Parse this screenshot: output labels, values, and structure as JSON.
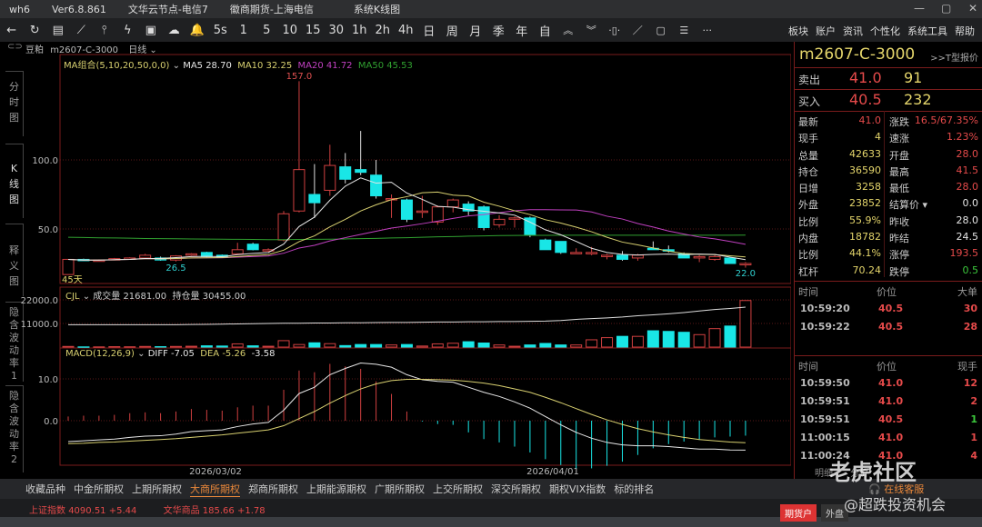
{
  "titlebar": {
    "app": "wh6",
    "version": "Ver6.8.861",
    "node": "文华云节点-电信7",
    "broker": "徽商期货-上海电信",
    "view": "系统K线图"
  },
  "toolbar": {
    "icons": [
      "back-icon",
      "refresh-icon",
      "table-icon",
      "line-chart-icon",
      "candle-icon",
      "flash-icon",
      "quote-board-icon",
      "cloud-icon",
      "bell-icon"
    ],
    "periods": [
      "5s",
      "1",
      "5",
      "10",
      "15",
      "30",
      "1h",
      "2h",
      "4h",
      "日",
      "周",
      "月",
      "季",
      "年",
      "自"
    ],
    "tools": [
      "expand-up-icon",
      "expand-down-icon",
      "fit-width-icon",
      "draw-line-icon",
      "rectangle-icon",
      "list-icon",
      "more-icon"
    ],
    "tool_glyphs": [
      "︽",
      "︾",
      "·▯·",
      "／",
      "▢",
      "☰",
      "···"
    ],
    "menu": [
      "板块",
      "账户",
      "资讯",
      "个性化",
      "系统工具",
      "帮助"
    ]
  },
  "header": {
    "name": "豆粕",
    "code": "m2607-C-3000",
    "period": "日线"
  },
  "sidebar": [
    "分时图",
    "K线图",
    "释义图",
    "隐含波动率1",
    "隐含波动率2"
  ],
  "legend": {
    "ma_label": "MA组合(5,10,20,50,0,0)",
    "ma5": "MA5 28.70",
    "ma10": "MA10 32.25",
    "ma20": "MA20 41.72",
    "ma50": "MA50 45.53",
    "cjl": "CJL",
    "vol": "成交量 21681.00",
    "oi": "持仓量 30455.00",
    "macd": "MACD(12,26,9)",
    "diff": "DIFF -7.05",
    "dea": "DEA -5.26",
    "hist": "-3.58",
    "high_label": "157.0",
    "low_label": "26.5",
    "last_low_label": "22.0",
    "days": "45天"
  },
  "colors": {
    "up": "#d04040",
    "down": "#19e6e6",
    "ma5": "#e6e6e6",
    "ma10": "#d8d070",
    "ma20": "#c040c0",
    "ma50": "#30a030",
    "yellow": "#e4d56b",
    "red": "#e54a4a",
    "green": "#3cc83c"
  },
  "chart_data": {
    "type": "candlestick",
    "price_axis": [
      "100.0",
      "50.0"
    ],
    "volume_axis": [
      "22000.0",
      "11000.0"
    ],
    "macd_axis": [
      "10.0",
      "0.0"
    ],
    "dates": [
      "2026/03/02",
      "2026/04/01"
    ],
    "ohlc": [
      [
        17,
        28,
        17,
        28
      ],
      [
        28,
        28.5,
        27,
        27
      ],
      [
        27,
        28,
        26.8,
        27.5
      ],
      [
        27.5,
        29,
        27.3,
        28.5
      ],
      [
        28.5,
        29.5,
        28,
        29
      ],
      [
        29,
        32,
        28.8,
        31
      ],
      [
        29,
        30,
        27,
        27.5
      ],
      [
        27.5,
        31,
        26.5,
        30.5
      ],
      [
        31,
        32.5,
        30.5,
        32
      ],
      [
        33,
        33.5,
        29.5,
        30
      ],
      [
        31,
        31.5,
        29,
        29.5
      ],
      [
        32,
        40,
        31.5,
        35
      ],
      [
        39,
        40,
        34.5,
        35
      ],
      [
        34,
        36,
        33.5,
        35
      ],
      [
        42,
        63,
        41,
        61
      ],
      [
        63,
        157,
        62,
        93
      ],
      [
        75,
        97,
        58,
        69
      ],
      [
        78,
        111,
        74,
        96
      ],
      [
        95,
        105,
        83,
        86
      ],
      [
        93,
        121,
        89,
        91
      ],
      [
        89,
        100,
        72,
        74
      ],
      [
        72,
        75,
        58,
        72
      ],
      [
        71,
        72,
        55,
        57
      ],
      [
        63,
        74,
        58,
        63
      ],
      [
        55,
        67,
        53,
        66
      ],
      [
        66,
        72,
        62,
        71
      ],
      [
        68,
        70,
        60,
        63
      ],
      [
        66,
        67,
        49,
        51
      ],
      [
        53,
        60,
        51,
        57
      ],
      [
        58,
        59,
        51,
        58
      ],
      [
        58,
        59,
        44,
        46
      ],
      [
        42,
        43,
        36,
        35
      ],
      [
        41,
        41,
        32,
        33
      ],
      [
        33,
        36,
        32,
        33
      ],
      [
        33,
        37,
        31,
        33
      ],
      [
        30,
        32,
        28,
        31
      ],
      [
        31,
        34,
        27,
        28
      ],
      [
        29,
        32,
        27,
        31
      ],
      [
        36,
        41,
        35,
        35
      ],
      [
        35,
        38,
        33,
        34
      ],
      [
        32,
        33,
        29,
        29
      ],
      [
        30,
        31,
        26,
        30
      ],
      [
        28,
        31,
        27,
        30
      ],
      [
        29,
        29,
        25,
        25
      ],
      [
        25,
        26,
        22,
        25
      ]
    ],
    "ma50": [
      44,
      43.8,
      43.6,
      43.5,
      43.3,
      43.1,
      43,
      42.9,
      42.8,
      42.7,
      42.6,
      42.5,
      42.4,
      42.3,
      42.3,
      42.4,
      42.5,
      42.6,
      42.8,
      43,
      43.2,
      43.5,
      43.7,
      44,
      44.3,
      44.5,
      44.8,
      45,
      45.2,
      45.3,
      45.4,
      45.4,
      45.5,
      45.5,
      45.5,
      45.5,
      45.5,
      45.5,
      45.5,
      45.5,
      45.5,
      45.5,
      45.5,
      45.5,
      45.53
    ],
    "volume": [
      300,
      100,
      100,
      200,
      150,
      300,
      200,
      300,
      400,
      600,
      500,
      1500,
      600,
      400,
      3000,
      1200,
      2000,
      1600,
      700,
      1200,
      1200,
      1000,
      1200,
      500,
      1500,
      1800,
      2500,
      1900,
      1000,
      400,
      1000,
      1700,
      1000,
      1000,
      3400,
      4400,
      5000,
      5000,
      7600,
      7300,
      6900,
      5800,
      8600,
      9800,
      21681
    ],
    "open_interest": [
      10400,
      10400,
      10400,
      10400,
      10400,
      10400,
      10400,
      10400,
      10500,
      10600,
      10700,
      10800,
      10900,
      11000,
      11100,
      11100,
      11200,
      11200,
      11300,
      11300,
      11400,
      11500,
      11500,
      11600,
      11700,
      11700,
      11800,
      11800,
      11900,
      11900,
      12000,
      12100,
      12400,
      12900,
      13300,
      13600,
      14000,
      14600,
      15000,
      15500,
      16100,
      16800,
      17500,
      18000,
      18600
    ],
    "diff": [
      -5,
      -4.8,
      -4.6,
      -4.4,
      -4,
      -3.7,
      -3.6,
      -3.2,
      -2.6,
      -2.4,
      -2.2,
      -1.4,
      -0.8,
      -0.4,
      2.5,
      6.5,
      8,
      11,
      12.5,
      13.8,
      13.5,
      12.8,
      11,
      9.8,
      9.4,
      9.2,
      8,
      6.8,
      5.8,
      4.5,
      3,
      1,
      -1,
      -2.8,
      -4.2,
      -5.2,
      -5.8,
      -6,
      -6,
      -6.2,
      -6.5,
      -6.8,
      -6.8,
      -7,
      -7.05
    ],
    "dea": [
      -5.5,
      -5.4,
      -5.2,
      -5.1,
      -4.9,
      -4.7,
      -4.5,
      -4.3,
      -4,
      -3.7,
      -3.4,
      -3,
      -2.6,
      -2.2,
      -1.2,
      0.5,
      2.2,
      4.2,
      6,
      7.6,
      8.8,
      9.6,
      9.9,
      9.9,
      9.8,
      9.7,
      9.4,
      9,
      8.4,
      7.6,
      6.8,
      5.6,
      4.3,
      2.9,
      1.5,
      0.2,
      -0.9,
      -1.9,
      -2.7,
      -3.4,
      -4,
      -4.5,
      -4.8,
      -5.1,
      -5.26
    ]
  },
  "quote": {
    "code": "m2607-C-3000",
    "t_link": ">>T型报价",
    "sell": {
      "label": "卖出",
      "price": "41.0",
      "vol": "91"
    },
    "buy": {
      "label": "买入",
      "price": "40.5",
      "vol": "232"
    },
    "stats": [
      {
        "l": "最新",
        "v": "41.0",
        "vc": "red",
        "l2": "涨跌",
        "v2": "16.5/67.35%",
        "v2c": "red"
      },
      {
        "l": "现手",
        "v": "4",
        "vc": "yellow",
        "l2": "速涨",
        "v2": "1.23%",
        "v2c": "red"
      },
      {
        "l": "总量",
        "v": "42633",
        "vc": "yellow",
        "l2": "开盘",
        "v2": "28.0",
        "v2c": "red"
      },
      {
        "l": "持仓",
        "v": "36590",
        "vc": "yellow",
        "l2": "最高",
        "v2": "41.5",
        "v2c": "red"
      },
      {
        "l": "日增",
        "v": "3258",
        "vc": "yellow",
        "l2": "最低",
        "v2": "28.0",
        "v2c": "red"
      },
      {
        "l": "外盘",
        "v": "23852",
        "vc": "yellow",
        "l2": "结算价 ▾",
        "v2": "0.0",
        "v2c": "white"
      },
      {
        "l": "比例",
        "v": "55.9%",
        "vc": "yellow",
        "l2": "昨收",
        "v2": "28.0",
        "v2c": "white"
      },
      {
        "l": "内盘",
        "v": "18782",
        "vc": "yellow",
        "l2": "昨结",
        "v2": "24.5",
        "v2c": "white"
      },
      {
        "l": "比例",
        "v": "44.1%",
        "vc": "yellow",
        "l2": "涨停",
        "v2": "193.5",
        "v2c": "red"
      },
      {
        "l": "杠杆",
        "v": "70.24",
        "vc": "yellow",
        "l2": "跌停",
        "v2": "0.5",
        "v2c": "green"
      }
    ],
    "big_orders": {
      "headers": [
        "时间",
        "价位",
        "大单"
      ],
      "rows": [
        [
          "10:59:20",
          "40.5",
          "30"
        ],
        [
          "10:59:22",
          "40.5",
          "28"
        ]
      ]
    },
    "ticks": {
      "headers": [
        "时间",
        "价位",
        "现手"
      ],
      "rows": [
        [
          "10:59:50",
          "41.0",
          "12",
          "red"
        ],
        [
          "10:59:51",
          "41.0",
          "2",
          "red"
        ],
        [
          "10:59:51",
          "40.5",
          "1",
          "green"
        ],
        [
          "11:00:15",
          "41.0",
          "1",
          "red"
        ],
        [
          "11:00:24",
          "41.0",
          "4",
          "red"
        ]
      ]
    },
    "tabs": [
      "明细",
      "分价"
    ]
  },
  "bottom_tabs": [
    "收藏品种",
    "中金所期权",
    "上期所期权",
    "大商所期权",
    "郑商所期权",
    "上期能源期权",
    "广期所期权",
    "上交所期权",
    "深交所期权",
    "期权VIX指数",
    "标的排名"
  ],
  "active_bottom_tab": "大商所期权",
  "indices": [
    {
      "name": "上证指数",
      "value": "4090.51",
      "change": "+5.44"
    },
    {
      "name": "文华商品",
      "value": "185.66",
      "change": "+1.78"
    }
  ],
  "service": "在线客服",
  "taskbar": {
    "account": "期货户",
    "outer": "外盘"
  },
  "watermark": {
    "main": "老虎社区",
    "sub": "@超跌投资机会"
  }
}
